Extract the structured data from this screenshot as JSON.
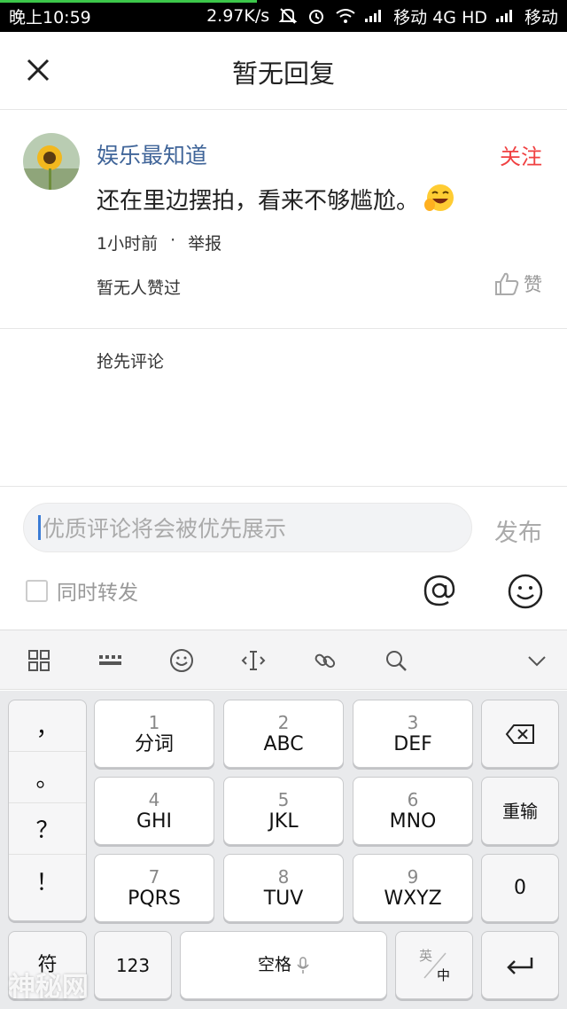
{
  "status_bar": {
    "time": "晚上10:59",
    "net_speed": "2.97K/s",
    "carrier1": "移动 4G HD",
    "carrier2": "移动"
  },
  "header": {
    "title": "暂无回复",
    "close_icon": "close-icon"
  },
  "comment": {
    "username": "娱乐最知道",
    "follow_label": "关注",
    "text": "还在里边摆拍，看来不够尴尬。",
    "emoji": "🤣",
    "time": "1小时前",
    "dot": "·",
    "report_label": "举报",
    "likes_text": "暂无人赞过",
    "like_label": "赞"
  },
  "first_comment_prompt": "抢先评论",
  "composer": {
    "placeholder": "优质评论将会被优先展示",
    "publish_label": "发布",
    "repost_label": "同时转发"
  },
  "keyboard": {
    "punct": [
      "，",
      "。",
      "？",
      "！"
    ],
    "keys": [
      {
        "num": "1",
        "label": "分词"
      },
      {
        "num": "2",
        "label": "ABC"
      },
      {
        "num": "3",
        "label": "DEF"
      },
      {
        "num": "4",
        "label": "GHI"
      },
      {
        "num": "5",
        "label": "JKL"
      },
      {
        "num": "6",
        "label": "MNO"
      },
      {
        "num": "7",
        "label": "PQRS"
      },
      {
        "num": "8",
        "label": "TUV"
      },
      {
        "num": "9",
        "label": "WXYZ"
      }
    ],
    "backspace_icon": "backspace-icon",
    "reenter_label": "重输",
    "zero_label": "0",
    "symbol_label": "符",
    "num_label": "123",
    "space_label": "空格",
    "lang_top": "英",
    "lang_bottom": "中",
    "enter_icon": "enter-icon"
  },
  "watermark": "神秘网"
}
